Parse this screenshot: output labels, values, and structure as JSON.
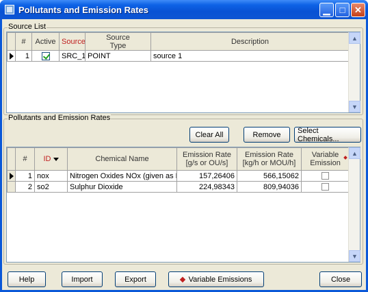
{
  "window": {
    "title": "Pollutants and Emission Rates",
    "minimize_glyph": "▁",
    "maximize_glyph": "□",
    "close_glyph": "✕"
  },
  "source_list": {
    "group_label": "Source List",
    "headers": [
      "#",
      "Active",
      "Source ID",
      "Source Type",
      "Description"
    ],
    "header_source_type_line1": "Source",
    "header_source_type_line2": "Type",
    "header_source_id_visible": "Source ID",
    "rows": [
      {
        "num": "1",
        "active": true,
        "source": "SRC_1",
        "type": "POINT",
        "description": "source 1"
      }
    ]
  },
  "pollutants": {
    "group_label": "Pollutants and Emission Rates",
    "buttons": {
      "clear_all": "Clear All",
      "remove": "Remove",
      "select_chemicals": "Select Chemicals..."
    },
    "headers": {
      "num": "#",
      "id": "ID",
      "chemical_name": "Chemical Name",
      "rate1_line1": "Emission Rate",
      "rate1_line2": "[g/s or OU/s]",
      "rate2_line1": "Emission Rate",
      "rate2_line2": "[kg/h or MOU/h]",
      "variable_line1": "Variable",
      "variable_line2": "Emission"
    },
    "rows": [
      {
        "num": "1",
        "id": "nox",
        "name": "Nitrogen Oxides NOx (given as N",
        "rate_gs": "157,26406",
        "rate_kgh": "566,15062",
        "variable": false
      },
      {
        "num": "2",
        "id": "so2",
        "name": "Sulphur Dioxide",
        "rate_gs": "224,98343",
        "rate_kgh": "809,94036",
        "variable": false
      }
    ]
  },
  "bottom_buttons": {
    "help": "Help",
    "import": "Import",
    "export": "Export",
    "variable_emissions": "Variable Emissions",
    "close": "Close"
  },
  "colors": {
    "titlebar": "#0852d4",
    "dialog_bg": "#ece9d8",
    "accent_red": "#c02020"
  }
}
